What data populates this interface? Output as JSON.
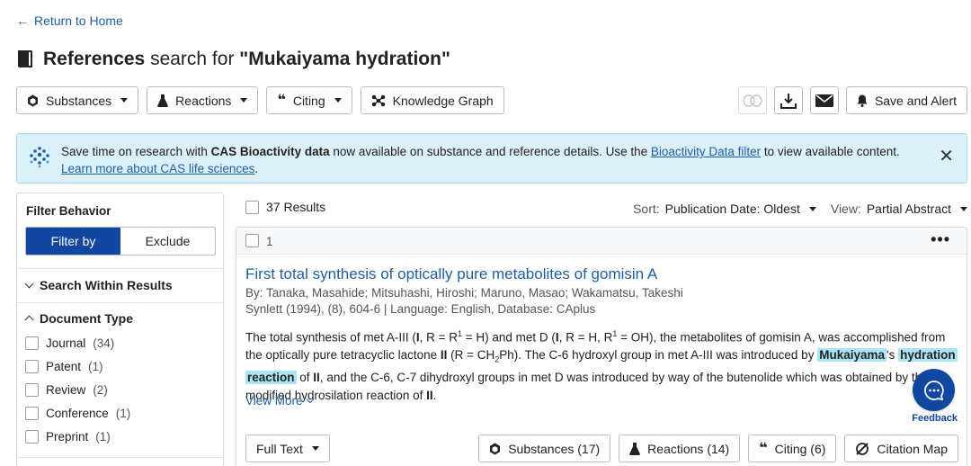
{
  "nav": {
    "return_label": "Return to Home"
  },
  "header": {
    "title_bold": "References",
    "title_rest": " search for ",
    "query": "\"Mukaiyama hydration\""
  },
  "toolbar": {
    "substances": "Substances",
    "reactions": "Reactions",
    "citing": "Citing",
    "knowledge_graph": "Knowledge Graph",
    "save_alert": "Save and Alert"
  },
  "banner": {
    "text_1": "Save time on research with ",
    "text_bold": "CAS Bioactivity data",
    "text_2": " now available on substance and reference details. Use the ",
    "link_filter": "Bioactivity Data filter",
    "text_3": " to view available content.",
    "link_learn": "Learn more about CAS life sciences",
    "text_end": "."
  },
  "sidebar": {
    "filter_behavior": "Filter Behavior",
    "filter_by": "Filter by",
    "exclude": "Exclude",
    "search_within": "Search Within Results",
    "doc_type": "Document Type",
    "doc_items": [
      {
        "label": "Journal",
        "count": "(34)"
      },
      {
        "label": "Patent",
        "count": "(1)"
      },
      {
        "label": "Review",
        "count": "(2)"
      },
      {
        "label": "Conference",
        "count": "(1)"
      },
      {
        "label": "Preprint",
        "count": "(1)"
      }
    ]
  },
  "results": {
    "count_label": "37 Results",
    "sort_label": "Sort:",
    "sort_value": "Publication Date: Oldest",
    "view_label": "View:",
    "view_value": "Partial Abstract"
  },
  "card": {
    "number": "1",
    "title": "First total synthesis of optically pure metabolites of gomisin A",
    "authors": "By: Tanaka, Masahide; Mitsuhashi, Hiroshi; Maruno, Masao; Wakamatsu, Takeshi",
    "source": "Synlett (1994), (8), 604-6 | Language: English, Database: CAplus",
    "view_more": "View More",
    "full_text": "Full Text",
    "substances": "Substances (17)",
    "reactions": "Reactions (14)",
    "citing": "Citing (6)",
    "citation_map": "Citation Map"
  },
  "feedback": {
    "label": "Feedback"
  },
  "colors": {
    "primary": "#1146a1",
    "link": "#1f5fa8",
    "highlight": "#a9e5f5",
    "banner": "#dcf0fa"
  }
}
